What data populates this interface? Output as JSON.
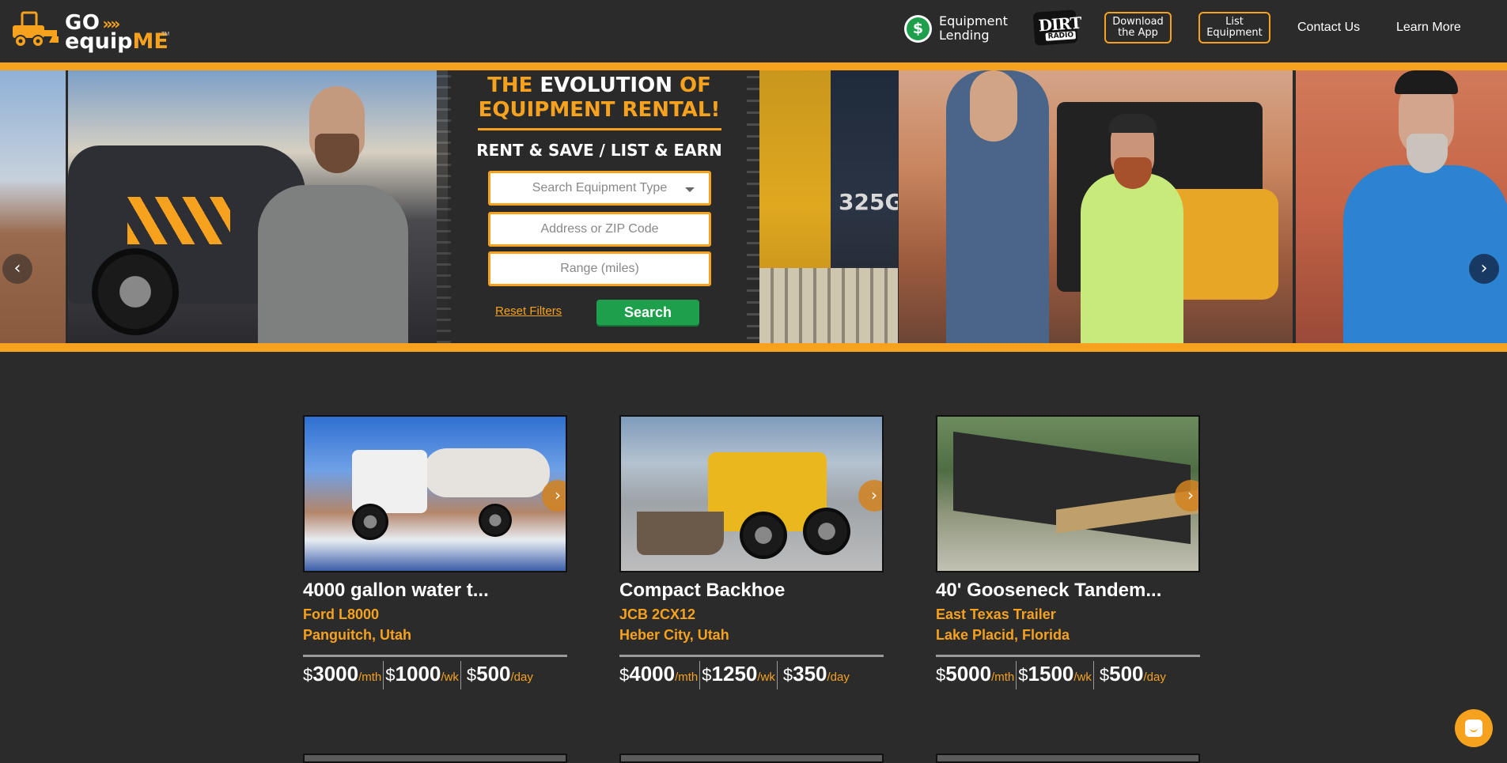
{
  "brand": {
    "logo_go": "GO",
    "logo_arrows": "»»",
    "logo_equip": "equip",
    "logo_me": "ME",
    "logo_tm": "TM"
  },
  "nav": {
    "equipment_lending": [
      "Equipment",
      "Lending"
    ],
    "dirt_radio": [
      "DIRT",
      "RADIO"
    ],
    "download_app": [
      "Download",
      "the App"
    ],
    "list_equipment": [
      "List",
      "Equipment"
    ],
    "contact": "Contact Us",
    "learn_more": "Learn More"
  },
  "hero": {
    "title_line1_a": "THE ",
    "title_line1_b": "EVOLUTION",
    "title_line1_c": " OF",
    "title_line2": "EQUIPMENT RENTAL!",
    "subtitle": "RENT & SAVE / LIST & EARN",
    "search_type_placeholder": "Search Equipment Type",
    "address_placeholder": "Address or ZIP Code",
    "range_placeholder": "Range (miles)",
    "reset_label": "Reset Filters",
    "search_label": "Search",
    "machine_label": "325G",
    "prev_icon": "‹",
    "next_icon": "›"
  },
  "listings": [
    {
      "title": "4000 gallon water t...",
      "make": "Ford L8000",
      "location": "Panguitch, Utah",
      "prices": [
        {
          "currency": "$",
          "amount": "3000",
          "period": "/mth"
        },
        {
          "currency": "$",
          "amount": "1000",
          "period": "/wk"
        },
        {
          "currency": "$",
          "amount": "500",
          "period": "/day"
        }
      ]
    },
    {
      "title": "Compact Backhoe",
      "make": "JCB 2CX12",
      "location": "Heber City, Utah",
      "prices": [
        {
          "currency": "$",
          "amount": "4000",
          "period": "/mth"
        },
        {
          "currency": "$",
          "amount": "1250",
          "period": "/wk"
        },
        {
          "currency": "$",
          "amount": "350",
          "period": "/day"
        }
      ]
    },
    {
      "title": "40' Gooseneck Tandem...",
      "make": "East Texas Trailer",
      "location": "Lake Placid, Florida",
      "prices": [
        {
          "currency": "$",
          "amount": "5000",
          "period": "/mth"
        },
        {
          "currency": "$",
          "amount": "1500",
          "period": "/wk"
        },
        {
          "currency": "$",
          "amount": "500",
          "period": "/day"
        }
      ]
    }
  ],
  "colors": {
    "accent": "#f6a21e",
    "background": "#2b2b2b",
    "search_green": "#1e9f4b",
    "text": "#ffffff"
  },
  "icons": {
    "chat": "chat-icon",
    "carousel_prev": "chevron-left-icon",
    "carousel_next": "chevron-right-icon",
    "card_next": "chevron-right-icon"
  }
}
